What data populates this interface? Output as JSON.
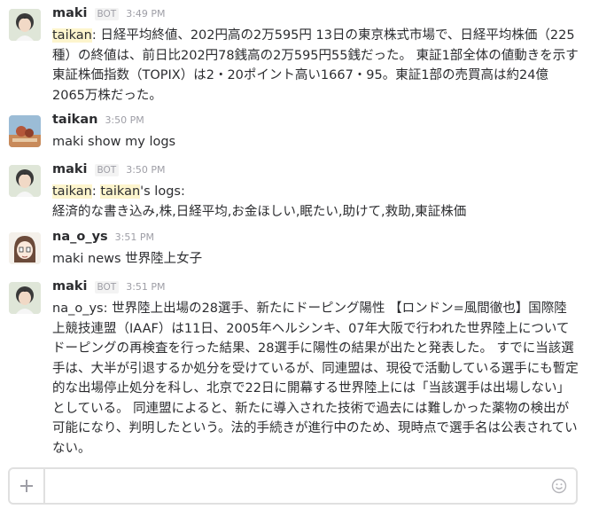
{
  "messages": [
    {
      "author": "maki",
      "bot_label": "BOT",
      "time": "3:49 PM",
      "mention": "taikan",
      "text": ": 日経平均終値、202円高の2万595円 13日の東京株式市場で、日経平均株価（225種）の終値は、前日比202円78銭高の2万595円55銭だった。 東証1部全体の値動きを示す東証株価指数（TOPIX）は2・20ポイント高い1667・95。東証1部の売買高は約24億2065万株だった。"
    },
    {
      "author": "taikan",
      "time": "3:50 PM",
      "text": "maki show my logs"
    },
    {
      "author": "maki",
      "bot_label": "BOT",
      "time": "3:50 PM",
      "mention": "taikan",
      "mention2": "taikan",
      "text_mid": ": ",
      "text_after": "'s logs:",
      "line2": "経済的な書き込み,株,日経平均,お金ほしい,眠たい,助けて,救助,東証株価"
    },
    {
      "author": "na_o_ys",
      "time": "3:51 PM",
      "text": "maki news 世界陸上女子"
    },
    {
      "author": "maki",
      "bot_label": "BOT",
      "time": "3:51 PM",
      "text": "na_o_ys: 世界陸上出場の28選手、新たにドーピング陽性 【ロンドン=風間徹也】国際陸上競技連盟（IAAF）は11日、2005年ヘルシンキ、07年大阪で行われた世界陸上についてドーピングの再検査を行った結果、28選手に陽性の結果が出たと発表した。 すでに当該選手は、大半が引退するか処分を受けているが、同連盟は、現役で活動している選手にも暫定的な出場停止処分を科し、北京で22日に開幕する世界陸上には「当該選手は出場しない」としている。 同連盟によると、新たに導入された技術で過去には難しかった薬物の検出が可能になり、判明したという。法的手続きが進行中のため、現時点で選手名は公表されていない。"
    }
  ],
  "composer": {
    "plus_icon": "plus-icon",
    "emoji_icon": "emoji-icon",
    "value": ""
  },
  "colors": {
    "mention_bg": "#fdf5cd",
    "border": "#e0e0e0",
    "muted": "#9e9ea6"
  }
}
